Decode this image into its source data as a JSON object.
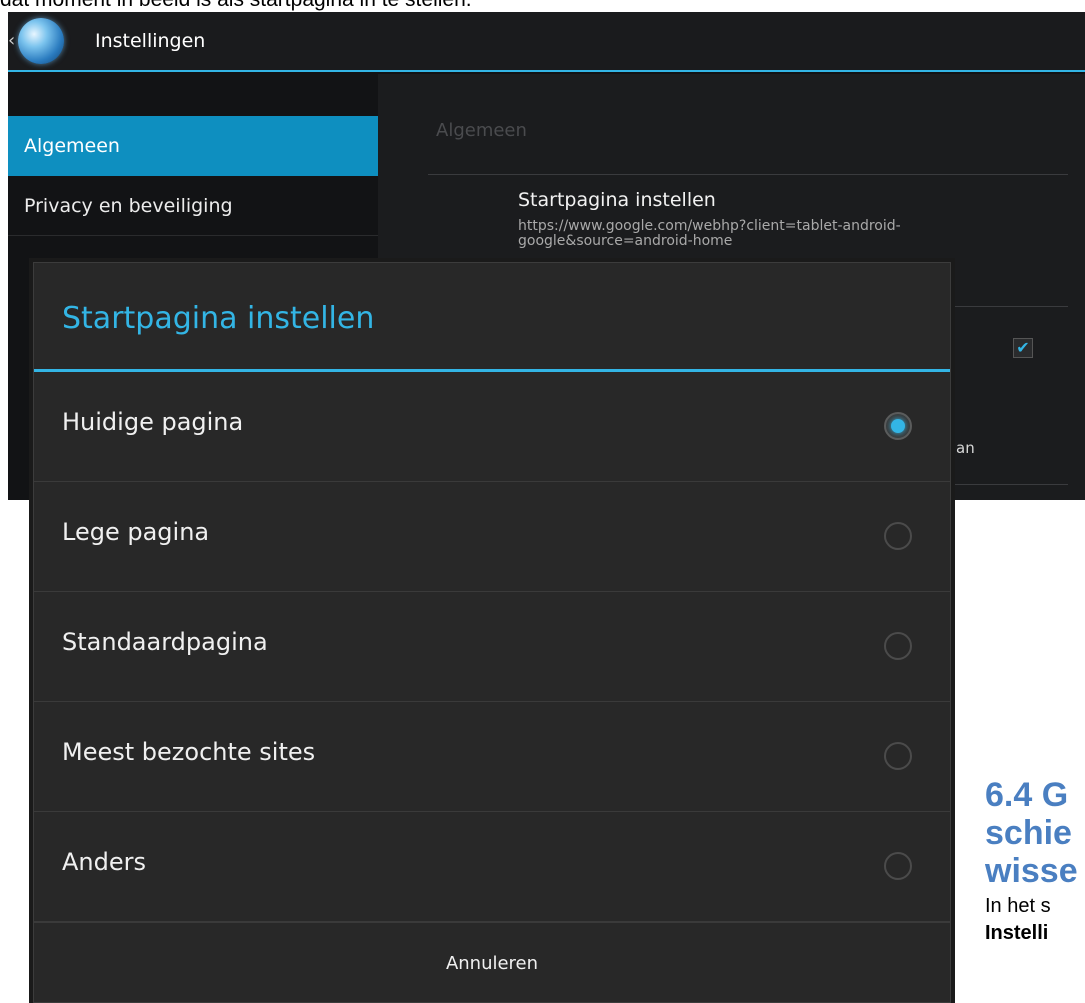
{
  "document": {
    "top_text": "dat moment in beeld is als startpagina in te stellen.",
    "heading_lines": [
      "6.4 G",
      "schie",
      "wisse"
    ],
    "para_line1": "In het s",
    "para_bold": "Instelli"
  },
  "settings": {
    "back_glyph": "‹",
    "app_icon": "globe-icon",
    "title": "Instellingen",
    "left_items": [
      {
        "label": "Algemeen",
        "selected": true
      },
      {
        "label": "Privacy en beveiliging",
        "selected": false
      }
    ],
    "section_header": "Algemeen",
    "pref_title": "Startpagina instellen",
    "pref_summary": "https://www.google.com/webhp?client=tablet-android-google&source=android-home",
    "partial_text": "an"
  },
  "dialog": {
    "title": "Startpagina instellen",
    "options": [
      {
        "label": "Huidige pagina",
        "checked": true
      },
      {
        "label": "Lege pagina",
        "checked": false
      },
      {
        "label": "Standaardpagina",
        "checked": false
      },
      {
        "label": "Meest bezochte sites",
        "checked": false
      },
      {
        "label": "Anders",
        "checked": false
      }
    ],
    "cancel_label": "Annuleren"
  },
  "colors": {
    "accent": "#33b5e5",
    "selected_item": "#0e8fc0",
    "doc_heading": "#4a7fc1"
  }
}
